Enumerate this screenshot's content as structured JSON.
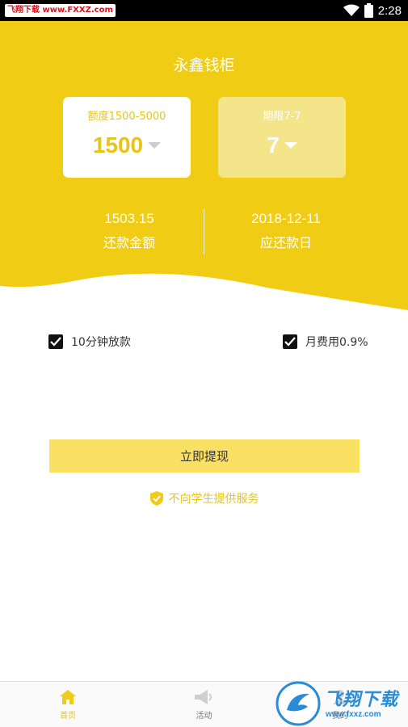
{
  "status_bar": {
    "time": "2:28",
    "watermark": "飞翔下载 www.FXXZ.com"
  },
  "app": {
    "title": "永鑫钱柜"
  },
  "amount_card": {
    "label": "额度1500-5000",
    "value": "1500"
  },
  "term_card": {
    "label": "期限7-7",
    "value": "7"
  },
  "repayment": {
    "amount": "1503.15",
    "amount_label": "还款金额",
    "date": "2018-12-11",
    "date_label": "应还款日"
  },
  "options": [
    {
      "label": "10分钟放款",
      "checked": true
    },
    {
      "label": "月费用0.9%",
      "checked": true
    }
  ],
  "withdraw_button": "立即提现",
  "notice": "不向学生提供服务",
  "tabs": [
    {
      "label": "首页",
      "icon": "home-icon",
      "active": true
    },
    {
      "label": "活动",
      "icon": "megaphone-icon",
      "active": false
    },
    {
      "label": "我的",
      "icon": "user-icon",
      "active": false
    }
  ],
  "watermark_bottom": {
    "brand": "飞翔下载",
    "url": "www.fxxz.com"
  },
  "colors": {
    "primary_yellow": "#f0cc15",
    "button_yellow": "#fbe163",
    "accent_text": "#e8c41a"
  }
}
